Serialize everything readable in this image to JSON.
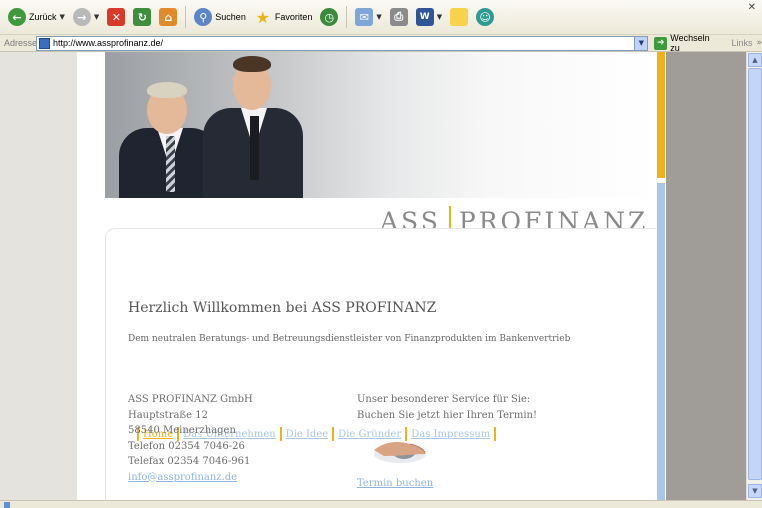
{
  "toolbar": {
    "back_label": "Zurück",
    "search_label": "Suchen",
    "favorites_label": "Favoriten",
    "close_glyph": "✕"
  },
  "addressbar": {
    "label": "Adresse",
    "url": "http://www.assprofinanz.de/",
    "go_label": "Wechseln zu",
    "links_label": "Links"
  },
  "site": {
    "brand_left": "ASS",
    "brand_right": "PROFINANZ",
    "nav": [
      {
        "label": "Home",
        "active": true
      },
      {
        "label": "Das Unternehmen",
        "active": false
      },
      {
        "label": "Die Idee",
        "active": false
      },
      {
        "label": "Die Gründer",
        "active": false
      },
      {
        "label": "Das Impressum",
        "active": false
      }
    ],
    "welcome_title": "Herzlich Willkommen bei ASS PROFINANZ",
    "welcome_subtitle": "Dem neutralen Beratungs- und Betreuungsdienstleister von Finanzprodukten im Bankenvertrieb",
    "address": {
      "company": "ASS PROFINANZ GmbH",
      "street": "Hauptstraße 12",
      "city": "58540 Meinerzhagen",
      "phone": "Telefon 02354 7046-26",
      "fax": "Telefax 02354 7046-961",
      "email": "info@assprofinanz.de"
    },
    "service": {
      "line1": "Unser besonderer Service für Sie:",
      "line2": "Buchen Sie jetzt hier Ihren Termin!",
      "link": "Termin buchen"
    }
  },
  "colors": {
    "accent_orange": "#f0b21c",
    "accent_blue": "#a9c7e4",
    "link_blue": "#8fb5dc",
    "text_gray": "#6c6c6c"
  }
}
